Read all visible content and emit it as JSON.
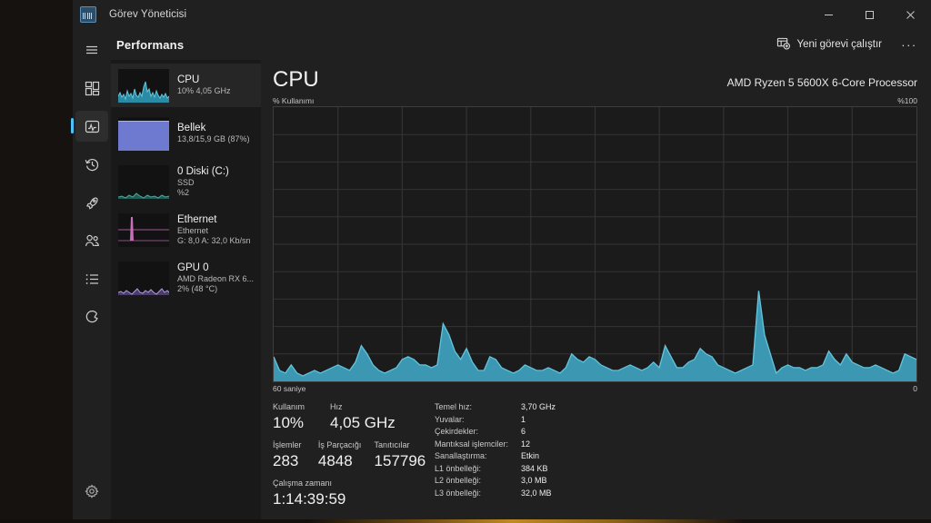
{
  "window": {
    "app_icon": "task-manager-icon",
    "title": "Görev Yöneticisi",
    "minimize_label": "—",
    "maximize_label": "□",
    "close_label": "✕"
  },
  "nav": {
    "items": [
      {
        "id": "hamburger",
        "icon": "hamburger-menu-icon",
        "label": ""
      },
      {
        "id": "processes",
        "icon": "processes-grid-icon",
        "label": ""
      },
      {
        "id": "performance",
        "icon": "performance-icon",
        "label": "",
        "selected": true
      },
      {
        "id": "app-history",
        "icon": "history-clock-icon",
        "label": ""
      },
      {
        "id": "startup-apps",
        "icon": "startup-rocket-icon",
        "label": ""
      },
      {
        "id": "users",
        "icon": "users-icon",
        "label": ""
      },
      {
        "id": "details",
        "icon": "details-list-icon",
        "label": ""
      },
      {
        "id": "services",
        "icon": "services-gear-icon",
        "label": ""
      }
    ],
    "settings_icon": "settings-gear-icon"
  },
  "commandbar": {
    "page_title": "Performans",
    "new_task_label": "Yeni görevi çalıştır",
    "new_task_icon": "new-task-icon",
    "more_label": "···"
  },
  "resources": [
    {
      "id": "cpu",
      "name": "CPU",
      "sub1": "10%  4,05 GHz",
      "sub2": "",
      "selected": true,
      "color": "#4ab0c8",
      "thumb": "cpu-sparkline"
    },
    {
      "id": "memory",
      "name": "Bellek",
      "sub1": "13,8/15,9 GB (87%)",
      "sub2": "",
      "selected": false,
      "color": "#7a86d8",
      "thumb": "memory-fill"
    },
    {
      "id": "disk0",
      "name": "0 Diski (C:)",
      "sub1": "SSD",
      "sub2": "%2",
      "selected": false,
      "color": "#4aa89a",
      "thumb": "disk-sparkline"
    },
    {
      "id": "ethernet",
      "name": "Ethernet",
      "sub1": "Ethernet",
      "sub2": "G: 8,0 A: 32,0 Kb/sn",
      "selected": false,
      "color": "#dd7fd0",
      "thumb": "ethernet-spike"
    },
    {
      "id": "gpu0",
      "name": "GPU 0",
      "sub1": "AMD Radeon RX 6...",
      "sub2": "2% (48 °C)",
      "selected": false,
      "color": "#b9a0e0",
      "thumb": "gpu-sparkline"
    }
  ],
  "detail": {
    "title": "CPU",
    "cpu_name": "AMD Ryzen 5 5600X 6-Core Processor",
    "graph_top_left_label": "% Kullanımı",
    "graph_top_right_label": "%100",
    "graph_bottom_left_label": "60 saniye",
    "graph_bottom_right_label": "0",
    "stats_left": [
      [
        {
          "label": "Kullanım",
          "value": "10%"
        },
        {
          "label": "Hız",
          "value": "4,05 GHz"
        }
      ],
      [
        {
          "label": "İşlemler",
          "value": "283"
        },
        {
          "label": "İş Parçacığı",
          "value": "4848"
        },
        {
          "label": "Tanıtıcılar",
          "value": "157796"
        }
      ],
      [
        {
          "label": "Çalışma zamanı",
          "value": "1:14:39:59"
        }
      ]
    ],
    "specs": [
      {
        "key": "Temel hız:",
        "value": "3,70 GHz"
      },
      {
        "key": "Yuvalar:",
        "value": "1"
      },
      {
        "key": "Çekirdekler:",
        "value": "6"
      },
      {
        "key": "Mantıksal işlemciler:",
        "value": "12"
      },
      {
        "key": "Sanallaştırma:",
        "value": "Etkin"
      },
      {
        "key": "L1 önbelleği:",
        "value": "384 KB"
      },
      {
        "key": "L2 önbelleği:",
        "value": "3,0 MB"
      },
      {
        "key": "L3 önbelleği:",
        "value": "32,0 MB"
      }
    ]
  },
  "colors": {
    "accent": "#4cc2ff",
    "cpu_graph_fill": "#3e9fba",
    "cpu_graph_stroke": "#63c3db",
    "window_bg": "#202020",
    "list_bg": "#191919",
    "graph_bg": "#1b1b1b",
    "grid_line": "#343434"
  },
  "chart_data": {
    "type": "area",
    "title": "% Kullanımı",
    "xlabel": "60 saniye",
    "ylabel": "% Kullanımı",
    "ylim": [
      0,
      100
    ],
    "xlim": [
      60,
      0
    ],
    "grid": true,
    "series_name": "CPU Kullanımı",
    "values": [
      9,
      4,
      3,
      6,
      3,
      2,
      3,
      4,
      3,
      4,
      5,
      6,
      5,
      4,
      7,
      13,
      10,
      6,
      4,
      3,
      4,
      5,
      8,
      9,
      8,
      6,
      6,
      5,
      6,
      21,
      17,
      11,
      8,
      12,
      7,
      4,
      4,
      9,
      8,
      5,
      4,
      3,
      4,
      6,
      5,
      4,
      4,
      5,
      4,
      3,
      5,
      10,
      8,
      7,
      9,
      8,
      6,
      5,
      4,
      4,
      5,
      6,
      5,
      4,
      5,
      7,
      5,
      13,
      9,
      5,
      5,
      7,
      8,
      12,
      10,
      9,
      6,
      5,
      4,
      3,
      4,
      5,
      6,
      33,
      17,
      10,
      3,
      5,
      6,
      5,
      5,
      4,
      5,
      5,
      6,
      11,
      8,
      6,
      10,
      7,
      6,
      5,
      5,
      6,
      5,
      4,
      3,
      4,
      10,
      9,
      8
    ]
  }
}
